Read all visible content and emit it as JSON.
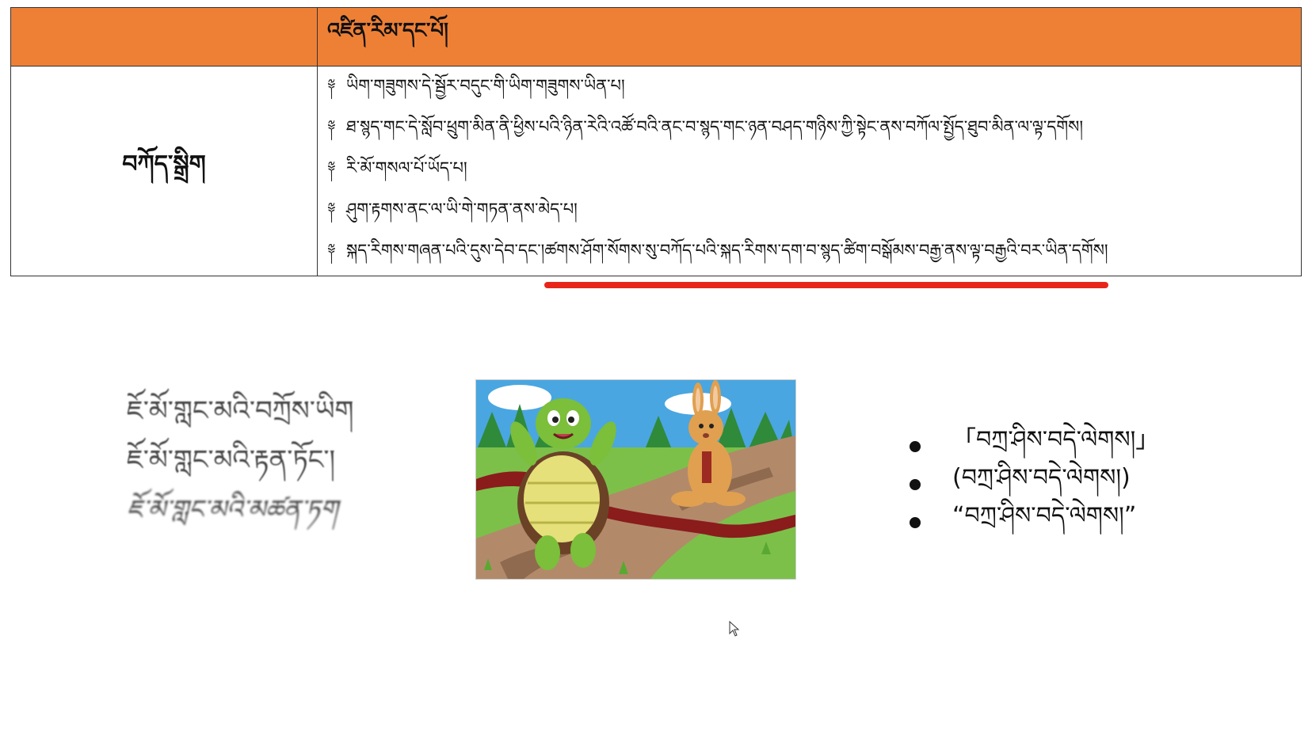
{
  "table": {
    "header_left": "",
    "header_title": "འཛིན་རིམ་དང་པོ།",
    "row_label": "བཀོད་སྒྲིག",
    "bullet_glyph": "༈",
    "items": [
      {
        "text": "ཡིག་གཟུགས་དེ་སྦྱོར་བདུང་གི་ཡིག་གཟུགས་ཡིན་པ།",
        "underlined": ""
      },
      {
        "text": "ཐ་སྙད་གང་དེ་སློབ་ཕྲུག་མིན་ནི་ཕྱིས་པའི་ཉིན་རེའི་འཚོ་བའི་ནང་བ་སྙད་གང་ཉན་བཤད་གཉིས་ཀྱི་སྟེང་ནས་བཀོལ་སྤྱོད་ཐུབ་མིན་ལ་ལྟ་དགོས།",
        "underlined": ""
      },
      {
        "text": "རི་མོ་གསལ་པོ་ཡོད་པ།",
        "underlined": ""
      },
      {
        "text": "ཤུག་རྟགས་ནང་ལ་ཡི་གེ་གཏན་ནས་མེད་པ།",
        "underlined": ""
      },
      {
        "text": "སྐད་རིགས་གཞན་པའི་དུས་དེབ་དང་། ",
        "underlined": "ཚགས་ཤོག་སོགས་སུ་བཀོད་པའི་སྐད་རིགས་དག་བ་སྙད་ཚིག་བསྒོམས་བརྒྱ་ནས་ལྟ་བརྒྱའི་བར་ཡིན་དགོས།"
      }
    ]
  },
  "font_samples": [
    "ཇོ་མོ་གླང་མའི་བཀྲོས་ཡིག",
    "ཇོ་མོ་གླང་མའི་རྟན་ཏོང་།",
    "ཇོ་མོ་གླང་མའི་མཚན་ཏག"
  ],
  "illustration": {
    "icon": "tortoise-and-hare-race-illustration"
  },
  "punctuation_examples": [
    "「བཀྲ་ཤིས་བདེ་ལེགས།」",
    "(བཀྲ་ཤིས་བདེ་ལེགས།)",
    "“བཀྲ་ཤིས་བདེ་ལེགས།”"
  ],
  "colors": {
    "header_bg": "#ee8036",
    "underline": "#e8251a"
  }
}
